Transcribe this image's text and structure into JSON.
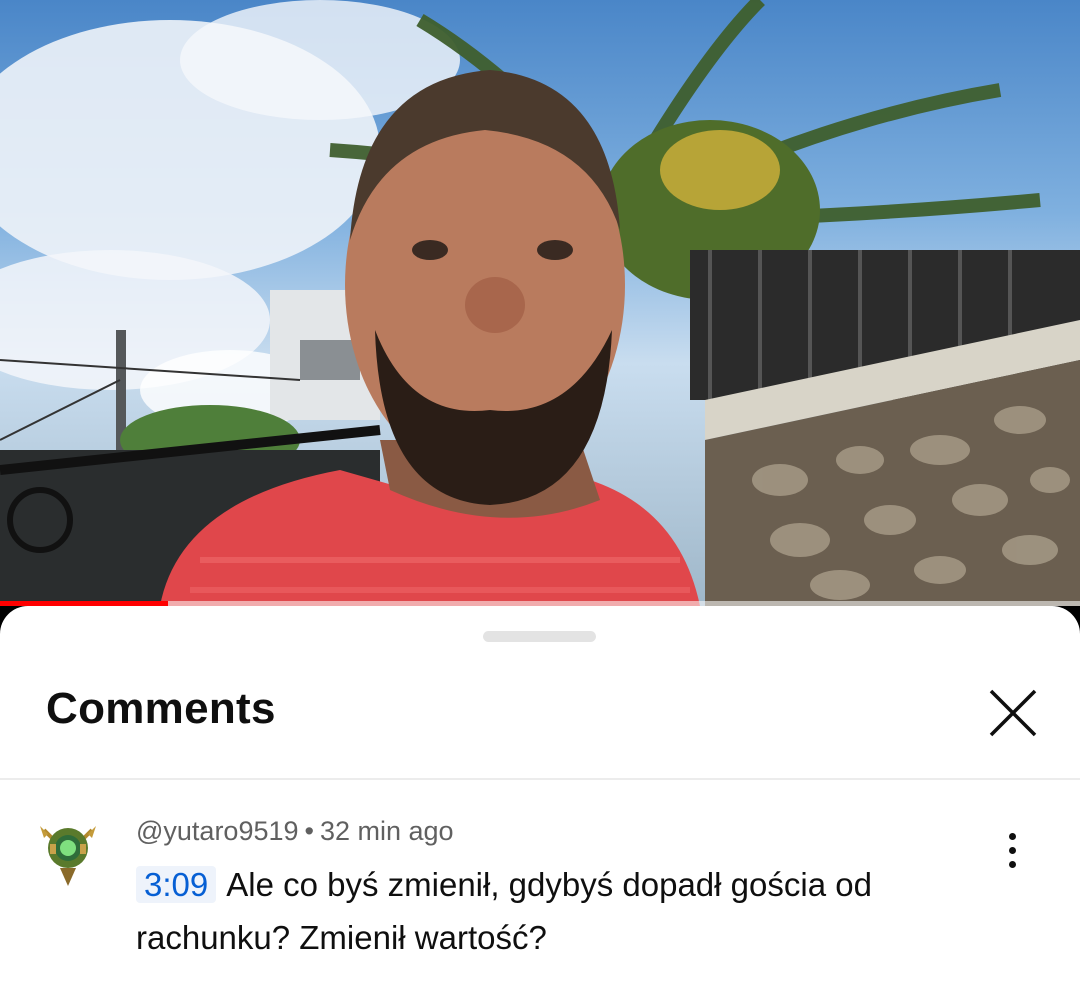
{
  "player": {
    "progress_fraction": 0.156
  },
  "comments_panel": {
    "title": "Comments",
    "close_icon": "close-icon"
  },
  "comment": {
    "author": "@yutaro9519",
    "separator": "•",
    "time_ago": "32 min ago",
    "timestamp": "3:09",
    "text": "Ale co byś zmienił, gdybyś dopadł gościa od rachunku? Zmienił wartość?",
    "more_icon": "more-vert-icon"
  },
  "colors": {
    "progress": "#ff0000",
    "link": "#065fd4"
  }
}
